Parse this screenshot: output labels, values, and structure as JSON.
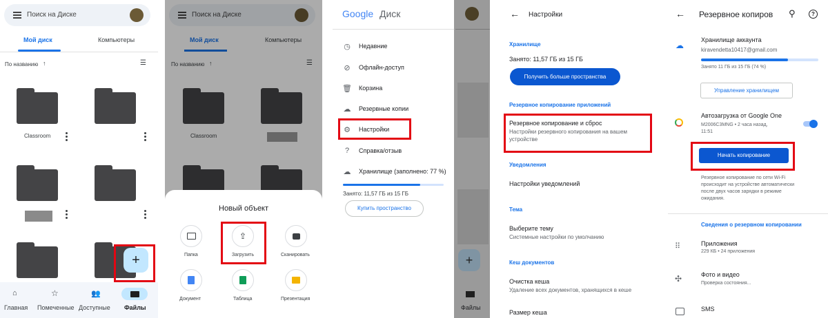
{
  "panel1": {
    "search_placeholder": "Поиск на Диске",
    "tab_my_drive": "Мой диск",
    "tab_computers": "Компьютеры",
    "sort_label": "По названию",
    "folder_classroom": "Classroom",
    "nav": [
      "Главная",
      "Помеченные",
      "Доступные",
      "Файлы"
    ],
    "fab": "+"
  },
  "panel2": {
    "search_placeholder": "Поиск на Диске",
    "tab_my_drive": "Мой диск",
    "tab_computers": "Компьютеры",
    "sort_label": "По названию",
    "folder_classroom": "Classroom",
    "sheet_title": "Новый объект",
    "actions": [
      "Папка",
      "Загрузить",
      "Сканировать",
      "Документ",
      "Таблица",
      "Презентация"
    ]
  },
  "panel3": {
    "logo_google": "Google",
    "logo_disk": "Диск",
    "menu": [
      "Недавние",
      "Офлайн-доступ",
      "Корзина",
      "Резервные копии",
      "Настройки",
      "Справка/отзыв",
      "Хранилище (заполнено: 77 %)"
    ],
    "storage_used": "Занято: 11,57 ГБ из 15 ГБ",
    "buy_button": "Купить пространство",
    "files_label": "Файлы"
  },
  "panel4": {
    "title": "Настройки",
    "section_storage": "Хранилище",
    "storage_used": "Занято: 11,57 ГБ из 15 ГБ",
    "more_space_button": "Получить больше пространства",
    "section_app_backup": "Резервное копирование приложений",
    "backup_title": "Резервное копирование и сброс",
    "backup_desc1": "Настройки резервного копирования на вашем",
    "backup_desc2": "устройстве",
    "section_notifications": "Уведомления",
    "notifications_settings": "Настройки уведомлений",
    "section_theme": "Тема",
    "theme_title": "Выберите тему",
    "theme_desc": "Системные настройки по умолчанию",
    "section_cache": "Кеш документов",
    "cache_clear": "Очистка кеша",
    "cache_clear_desc": "Удаление всех документов, хранящихся в кеше",
    "cache_size": "Размер кеша"
  },
  "panel5": {
    "title": "Резервное копиров",
    "account_storage": "Хранилище аккаунта",
    "email": "kiravendetta10417@gmail.com",
    "storage_used": "Занято 11 ГБ из 15 ГБ (74 %)",
    "storage_fraction": 0.74,
    "manage_button": "Управление хранилищем",
    "autoupload_title": "Автозагрузка от Google One",
    "device_line1": "M2006C3MNG • 2 часа назад,",
    "device_line2": "11:51",
    "start_backup_button": "Начать копирование",
    "wifi_note": [
      "Резервное копирование по сети Wi-Fi",
      "происходит на устройстве автоматически",
      "после двух часов зарядки в режиме",
      "ожидания."
    ],
    "section_backup_info": "Сведения о резервном копировании",
    "apps_title": "Приложения",
    "apps_desc": "229 КБ • 24 приложения",
    "photos_title": "Фото и видео",
    "photos_desc": "Проверка состояния...",
    "sms_title": "SMS"
  }
}
